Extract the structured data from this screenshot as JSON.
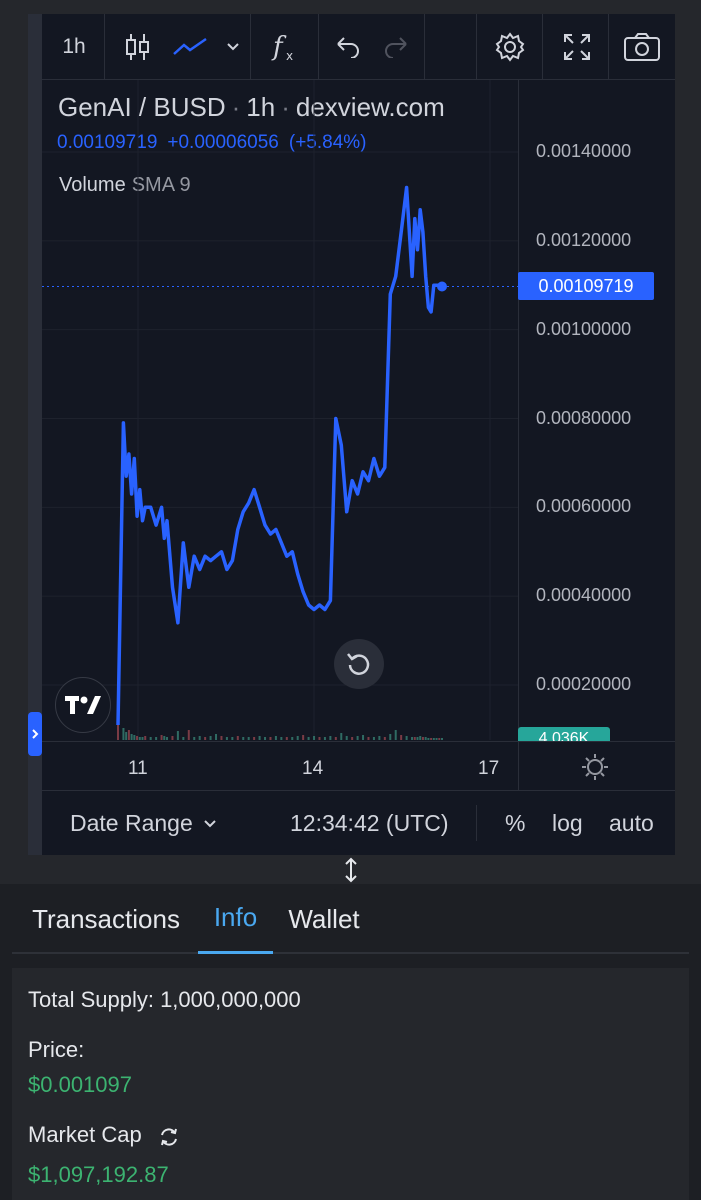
{
  "toolbar": {
    "interval": "1h",
    "icons": [
      "candles-icon",
      "line-chart-icon",
      "chevron-down-icon",
      "function-icon",
      "undo-icon",
      "redo-icon",
      "gear-icon",
      "fullscreen-icon",
      "camera-icon"
    ]
  },
  "legend": {
    "pair": "GenAI / BUSD",
    "interval": "1h",
    "source": "dexview.com",
    "price": "0.00109719",
    "change_abs": "+0.00006056",
    "change_pct": "(+5.84%)",
    "volume_label": "Volume",
    "volume_sma": "SMA 9"
  },
  "chart_data": {
    "type": "line",
    "series_color": "#2962ff",
    "x_ticks": [
      "11",
      "14",
      "17"
    ],
    "y_ticks": [
      "0.00140000",
      "0.00120000",
      "0.00100000",
      "0.00080000",
      "0.00060000",
      "0.00040000",
      "0.00020000"
    ],
    "ylim": [
      0.0,
      0.0015
    ],
    "current_price_label": "0.00109719",
    "volume_badge": "4.036K",
    "x": [
      0,
      2,
      3,
      4,
      5,
      6,
      7,
      8,
      9,
      10,
      12,
      14,
      16,
      17,
      18,
      20,
      22,
      24,
      26,
      28,
      30,
      32,
      34,
      36,
      38,
      40,
      42,
      44,
      46,
      48,
      50,
      52,
      54,
      56,
      58,
      60,
      62,
      64,
      66,
      68,
      70,
      72,
      74,
      76,
      78,
      80,
      82,
      84,
      86,
      88,
      90,
      92,
      94,
      96,
      98,
      100,
      102,
      104,
      106,
      108,
      109,
      110,
      111,
      112,
      113,
      114,
      115,
      116,
      117,
      118,
      119
    ],
    "y": [
      0.00011,
      0.00079,
      0.00067,
      0.00072,
      0.00063,
      0.00071,
      0.00058,
      0.00064,
      0.00057,
      0.0006,
      0.0006,
      0.00056,
      0.0006,
      0.00053,
      0.00057,
      0.00042,
      0.00034,
      0.00052,
      0.00042,
      0.00049,
      0.00046,
      0.00049,
      0.00048,
      0.00049,
      0.0005,
      0.00046,
      0.00048,
      0.00055,
      0.00059,
      0.00061,
      0.00064,
      0.0006,
      0.00056,
      0.00054,
      0.00055,
      0.00052,
      0.00049,
      0.0005,
      0.00045,
      0.00041,
      0.00038,
      0.00037,
      0.00038,
      0.00037,
      0.00039,
      0.0008,
      0.00074,
      0.00059,
      0.00066,
      0.00063,
      0.00068,
      0.00066,
      0.00071,
      0.00067,
      0.00069,
      0.00108,
      0.00112,
      0.00122,
      0.00132,
      0.00112,
      0.00125,
      0.00118,
      0.00127,
      0.00122,
      0.00112,
      0.00105,
      0.00104,
      0.0011,
      0.0011,
      0.0011,
      0.00109719
    ],
    "volume": [
      22,
      12,
      8,
      10,
      6,
      5,
      4,
      3,
      3,
      4,
      3,
      3,
      5,
      4,
      3,
      4,
      9,
      3,
      10,
      3,
      4,
      3,
      4,
      6,
      4,
      3,
      3,
      4,
      3,
      3,
      3,
      4,
      3,
      3,
      4,
      3,
      3,
      3,
      4,
      5,
      3,
      4,
      3,
      3,
      4,
      3,
      7,
      4,
      3,
      4,
      5,
      3,
      3,
      4,
      3,
      6,
      10,
      5,
      4,
      3,
      3,
      3,
      4,
      3,
      3,
      2,
      2,
      2,
      2,
      2,
      2
    ]
  },
  "bottom_bar": {
    "date_range": "Date Range",
    "time": "12:34:42 (UTC)",
    "percent": "%",
    "log": "log",
    "auto": "auto"
  },
  "tabs": [
    {
      "label": "Transactions",
      "active": false
    },
    {
      "label": "Info",
      "active": true
    },
    {
      "label": "Wallet",
      "active": false
    }
  ],
  "info": {
    "total_supply": "Total Supply: 1,000,000,000",
    "price_label": "Price:",
    "price_value": "$0.001097",
    "market_cap_label": "Market Cap",
    "market_cap_value": "$1,097,192.87"
  }
}
